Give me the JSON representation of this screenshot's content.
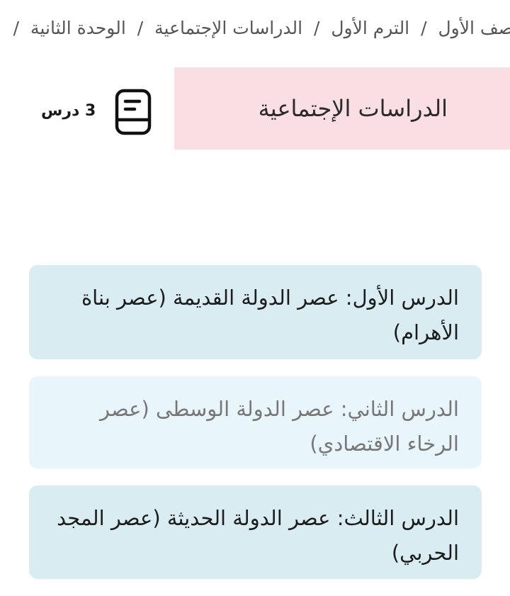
{
  "breadcrumb": {
    "items": [
      "الصف الأول",
      "الترم الأول",
      "الدراسات الإجتماعية",
      "الوحدة الثانية"
    ],
    "separator": "/"
  },
  "subject": {
    "title": "الدراسات الإجتماعية",
    "lesson_count": "3 درس",
    "icon": "book-icon",
    "banner_color": "#f9dfe4"
  },
  "lessons": [
    {
      "title": "الدرس الأول: عصر الدولة القديمة (عصر بناة الأهرام)"
    },
    {
      "title": "الدرس الثاني: عصر الدولة الوسطى (عصر الرخاء الاقتصادي)"
    },
    {
      "title": "الدرس الثالث: عصر الدولة الحديثة (عصر المجد الحربي)"
    }
  ],
  "colors": {
    "card": "#d9ecf2",
    "card_light": "#e8f5fa"
  }
}
